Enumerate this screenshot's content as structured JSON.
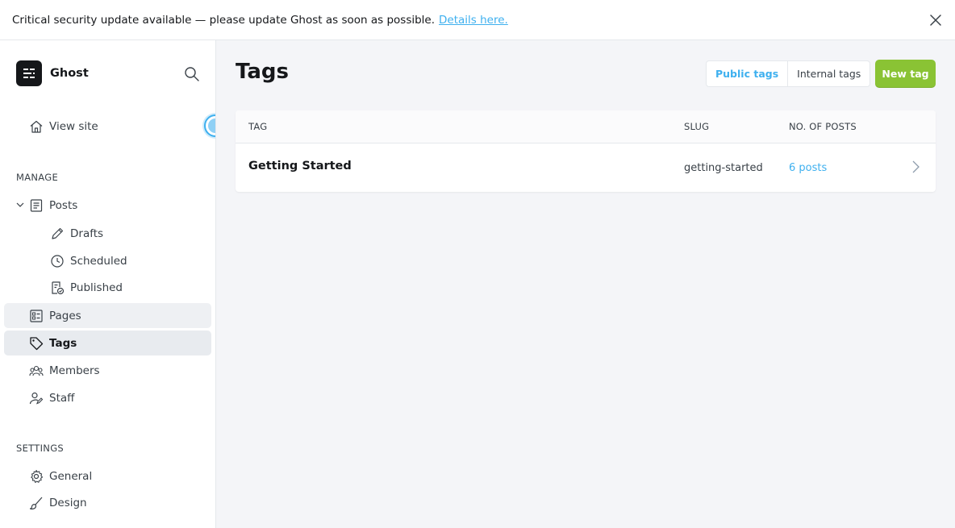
{
  "banner": {
    "message": "Critical security update available — please update Ghost as soon as possible.",
    "link": "Details here.",
    "close_icon": "close-icon"
  },
  "sidebar": {
    "brand": {
      "name": "Ghost",
      "logo_icon": "ghost-logo-icon"
    },
    "search_icon": "search-icon",
    "view_site": {
      "label": "View site",
      "icon": "home-icon"
    },
    "manage_label": "MANAGE",
    "manage_items": [
      {
        "label": "Posts",
        "icon": "posts-icon"
      },
      {
        "label": "Drafts",
        "icon": "pencil-icon"
      },
      {
        "label": "Scheduled",
        "icon": "clock-icon"
      },
      {
        "label": "Published",
        "icon": "published-icon"
      },
      {
        "label": "Pages",
        "icon": "pages-icon"
      },
      {
        "label": "Tags",
        "icon": "tag-icon",
        "active": true
      },
      {
        "label": "Members",
        "icon": "members-icon"
      },
      {
        "label": "Staff",
        "icon": "staff-icon"
      }
    ],
    "settings_label": "SETTINGS",
    "settings_items": [
      {
        "label": "General",
        "icon": "gear-icon"
      },
      {
        "label": "Design",
        "icon": "brush-icon"
      }
    ]
  },
  "main": {
    "title": "Tags",
    "filters": {
      "public": "Public tags",
      "internal": "Internal tags",
      "selected": "Public tags"
    },
    "new_tag_label": "New tag",
    "table": {
      "headers": {
        "tag": "TAG",
        "slug": "SLUG",
        "posts": "NO. OF POSTS"
      },
      "rows": [
        {
          "name": "Getting Started",
          "slug": "getting-started",
          "count": "6 posts"
        }
      ]
    }
  },
  "colors": {
    "accent": "#3eb0ef",
    "primary_button": "#8ac334",
    "sidebar_active": "#e8ebef",
    "background": "#f4f5f8"
  }
}
